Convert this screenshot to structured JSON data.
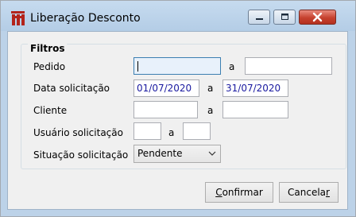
{
  "window": {
    "title": "Liberação Desconto",
    "icon": "app-logo-icon",
    "controls": [
      "minimize-icon",
      "maximize-icon",
      "close-icon"
    ]
  },
  "filters": {
    "legend": "Filtros",
    "separator": "a",
    "pedido": {
      "label": "Pedido",
      "from": "",
      "to": ""
    },
    "data_solicitacao": {
      "label": "Data solicitação",
      "from": "01/07/2020",
      "to": "31/07/2020"
    },
    "cliente": {
      "label": "Cliente",
      "from": "",
      "to": ""
    },
    "usuario_solicitacao": {
      "label": "Usuário solicitação",
      "from": "",
      "to": ""
    },
    "situacao_solicitacao": {
      "label": "Situação solicitação",
      "selected": "Pendente"
    }
  },
  "buttons": {
    "confirmar": {
      "label": "Confirmar",
      "mnemonic": "C"
    },
    "cancelar": {
      "label": "Cancelar",
      "mnemonic": "r"
    }
  },
  "colors": {
    "titlebar": "#bcd2e8",
    "close_button": "#c6422f",
    "date_text": "#1a1aa0"
  }
}
